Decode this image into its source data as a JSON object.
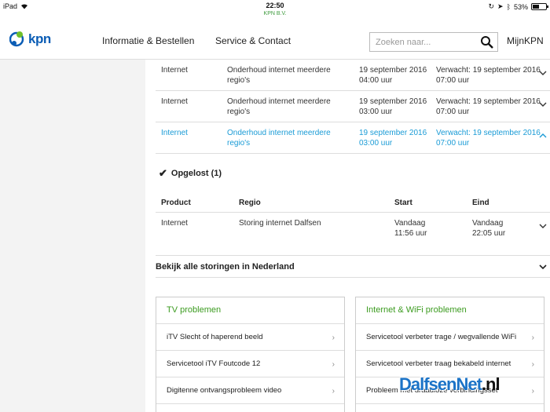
{
  "status_bar": {
    "device": "iPad",
    "time": "22:50",
    "carrier": "KPN B.V.",
    "battery": "53%",
    "battery_level": 0.53
  },
  "header": {
    "logo_text": "kpn",
    "nav": [
      "Informatie & Bestellen",
      "Service & Contact"
    ],
    "search_placeholder": "Zoeken naar...",
    "account_link": "MijnKPN"
  },
  "outages": [
    {
      "product": "Internet",
      "regio": "Onderhoud internet meerdere regio's",
      "start": "19 september 2016 04:00 uur",
      "eind": "Verwacht: 19 september 2016 07:00 uur",
      "active": false
    },
    {
      "product": "Internet",
      "regio": "Onderhoud internet meerdere regio's",
      "start": "19 september 2016 03:00 uur",
      "eind": "Verwacht: 19 september 2016 07:00 uur",
      "active": false
    },
    {
      "product": "Internet",
      "regio": "Onderhoud internet meerdere regio's",
      "start": "19 september 2016 03:00 uur",
      "eind": "Verwacht: 19 september 2016 07:00 uur",
      "active": true
    }
  ],
  "solved": {
    "heading": "Opgelost (1)",
    "columns": [
      "Product",
      "Regio",
      "Start",
      "Eind"
    ],
    "row": {
      "product": "Internet",
      "regio": "Storing internet Dalfsen",
      "start_1": "Vandaag",
      "start_2": "11:56 uur",
      "eind_1": "Vandaag",
      "eind_2": "22:05 uur"
    }
  },
  "all_outages_link": "Bekijk alle storingen in Nederland",
  "cards": {
    "tv": {
      "title": "TV problemen",
      "items": [
        "iTV Slecht of haperend beeld",
        "Servicetool iTV Foutcode 12",
        "Digitenne ontvangsprobleem video"
      ]
    },
    "internet": {
      "title": "Internet & WiFi problemen",
      "items": [
        "Servicetool verbeter trage / wegvallende WiFi",
        "Servicetool verbeter traag bekabeld internet",
        "Probleem met draadloze verbindingsset"
      ]
    }
  },
  "watermark": {
    "main": "DalfsenNet",
    "suffix": ".nl"
  },
  "colors": {
    "brand_blue": "#0b5db5",
    "link_blue": "#1a9bd6",
    "green": "#3b9b1f"
  }
}
